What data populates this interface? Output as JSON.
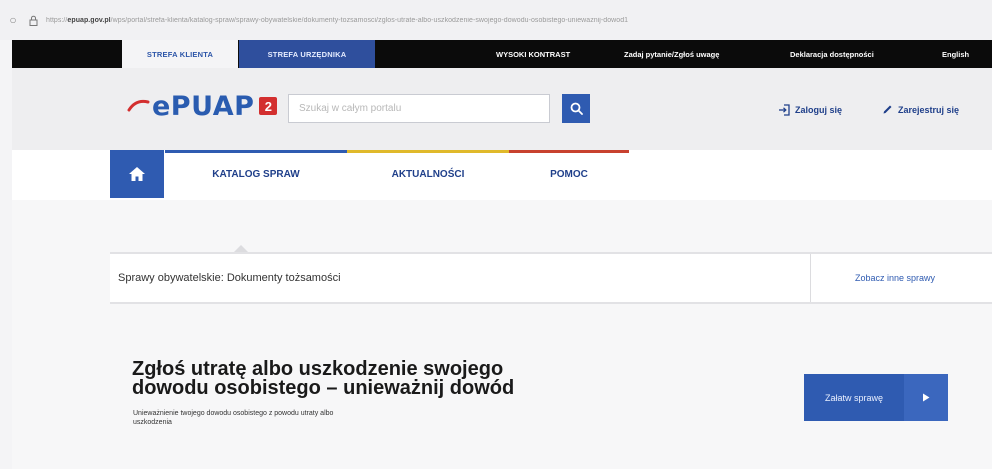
{
  "browser": {
    "url_prefix": "https://",
    "url_domain": "epuap.gov.pl",
    "url_path": "/wps/portal/strefa-klienta/katalog-spraw/sprawy-obywatelskie/dokumenty-tozsamosci/zglos-utrate-albo-uszkodzenie-swojego-dowodu-osobistego-uniewaznij-dowod1"
  },
  "topbar": {
    "zone_client": "STREFA KLIENTA",
    "zone_official": "STREFA URZĘDNIKA",
    "high_contrast": "WYSOKI KONTRAST",
    "ask_question": "Zadaj pytanie/Zgłoś uwagę",
    "accessibility": "Deklaracja dostępności",
    "english": "English"
  },
  "header": {
    "logo_text": "ePUAP",
    "logo_number": "2",
    "search_placeholder": "Szukaj w całym portalu",
    "login": "Zaloguj się",
    "register": "Zarejestruj się"
  },
  "nav": {
    "items": [
      {
        "label": "KATALOG SPRAW",
        "color": "#2f5bb1"
      },
      {
        "label": "AKTUALNOŚCI",
        "color": "#e0b92a"
      },
      {
        "label": "POMOC",
        "color": "#c8412f"
      }
    ]
  },
  "breadcrumb": {
    "text": "Sprawy obywatelskie: Dokumenty tożsamości",
    "other_link": "Zobacz inne sprawy"
  },
  "service": {
    "title_line1": "Zgłoś utratę albo uszkodzenie swojego",
    "title_line2": "dowodu osobistego – unieważnij dowód",
    "desc_line1": "Unieważnienie twojego dowodu osobistego z powodu utraty albo",
    "desc_line2": "uszkodzenia",
    "start_button": "Załatw sprawę"
  },
  "colors": {
    "brand_blue": "#2f5bb1",
    "brand_red": "#d32f2f",
    "accent_yellow": "#e0b92a",
    "accent_red": "#c8412f"
  }
}
